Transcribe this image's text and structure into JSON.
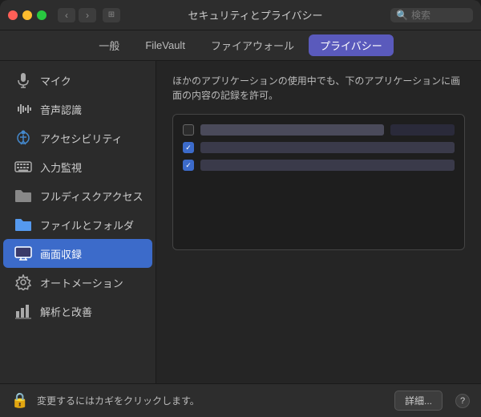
{
  "titlebar": {
    "title": "セキュリティとプライバシー",
    "search_placeholder": "検索"
  },
  "tabs": [
    {
      "id": "general",
      "label": "一般",
      "active": false
    },
    {
      "id": "filevault",
      "label": "FileVault",
      "active": false
    },
    {
      "id": "firewall",
      "label": "ファイアウォール",
      "active": false
    },
    {
      "id": "privacy",
      "label": "プライバシー",
      "active": true
    }
  ],
  "sidebar": {
    "items": [
      {
        "id": "microphone",
        "label": "マイク",
        "icon": "microphone"
      },
      {
        "id": "speech",
        "label": "音声認識",
        "icon": "waveform"
      },
      {
        "id": "accessibility",
        "label": "アクセシビリティ",
        "icon": "accessibility"
      },
      {
        "id": "input",
        "label": "入力監視",
        "icon": "keyboard"
      },
      {
        "id": "fulldisk",
        "label": "フルディスクアクセス",
        "icon": "folder"
      },
      {
        "id": "files",
        "label": "ファイルとフォルダ",
        "icon": "folder-blue"
      },
      {
        "id": "screen",
        "label": "画面収録",
        "icon": "screen",
        "active": true
      },
      {
        "id": "automation",
        "label": "オートメーション",
        "icon": "gear"
      },
      {
        "id": "analytics",
        "label": "解析と改善",
        "icon": "chart"
      }
    ]
  },
  "panel": {
    "description": "ほかのアプリケーションの使用中でも、下のアプリケーションに画面の内容の記録を許可。",
    "apps": [
      {
        "id": "app1",
        "checked": false,
        "name": ""
      },
      {
        "id": "app2",
        "checked": true,
        "name": ""
      },
      {
        "id": "app3",
        "checked": true,
        "name": ""
      }
    ]
  },
  "footer": {
    "lock_text": "変更するにはカギをクリックします。",
    "details_label": "詳細...",
    "help_label": "?"
  }
}
